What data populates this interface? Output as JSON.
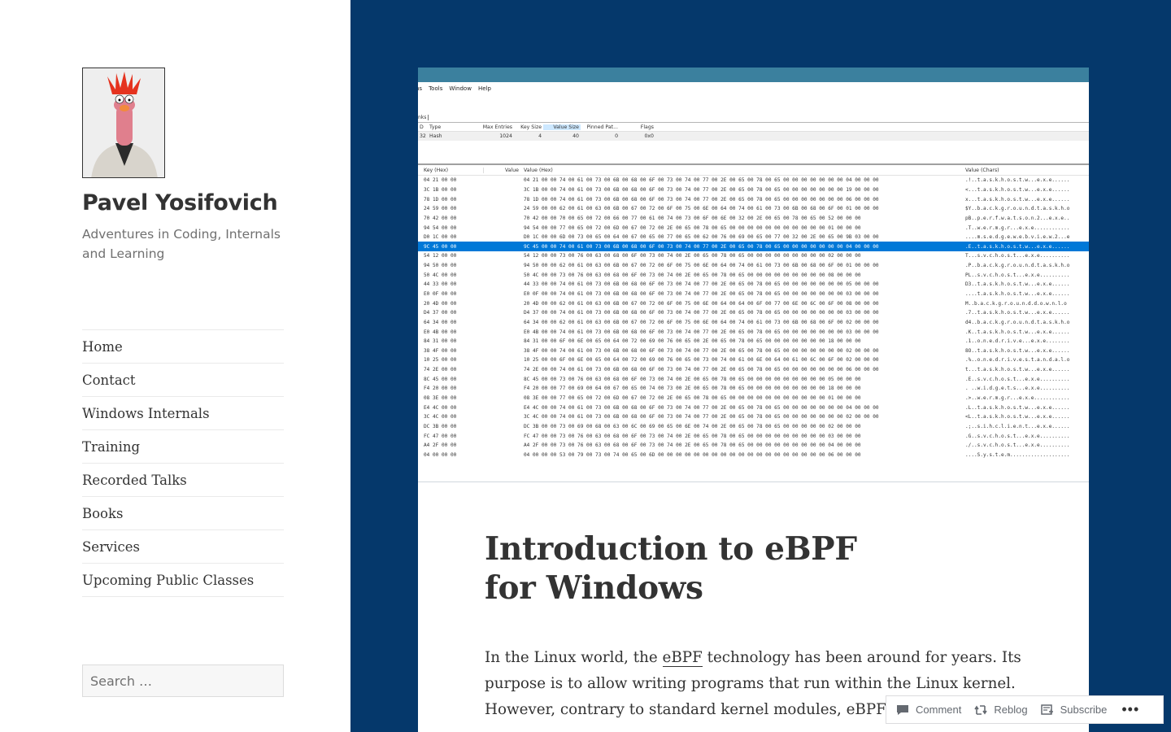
{
  "site": {
    "title": "Pavel Yosifovich",
    "description": "Adventures in Coding, Internals and Learning"
  },
  "nav": [
    "Home",
    "Contact",
    "Windows Internals",
    "Training",
    "Recorded Talks",
    "Books",
    "Services",
    "Upcoming Public Classes"
  ],
  "search": {
    "placeholder": "Search …"
  },
  "post": {
    "title_line1": "Introduction to eBPF",
    "title_line2": "for Windows",
    "body_p1_before": "In the Linux world, the ",
    "body_p1_link": "eBPF",
    "body_p1_after": " technology has been around for years. Its purpose is to allow writing programs that run within the Linux kernel. However, contrary to standard kernel modules, eBPF r"
  },
  "hero": {
    "menu": [
      "ns",
      "Tools",
      "Window",
      "Help"
    ],
    "tab": "nks",
    "maps_columns": [
      "D",
      "Type",
      "Max Entries",
      "Key Size",
      "Value Size",
      "Pinned Pat...",
      "Flags"
    ],
    "maps_row": [
      "32",
      "Hash",
      "1024",
      "4",
      "40",
      "0",
      "0x0"
    ],
    "hex_columns": [
      "Key (Hex)",
      "Value",
      "Value (Hex)",
      "Value (Chars)"
    ],
    "selected_index": 7,
    "hex_rows": [
      [
        "04 21 00 00",
        "04 21 00 00 74 00 61 00 73 00 6B 00 68 00 6F 00 73 00 74 00 77 00 2E 00 65 00 78 00 65 00 00 00 00 00 00 00 04 00 00 00",
        ".!..t.a.s.k.h.o.s.t.w...e.x.e......"
      ],
      [
        "3C 1B 00 00",
        "3C 1B 00 00 74 00 61 00 73 00 6B 00 68 00 6F 00 73 00 74 00 77 00 2E 00 65 00 78 00 65 00 00 00 00 00 00 00 19 00 00 00",
        "<...t.a.s.k.h.o.s.t.w...e.x.e......"
      ],
      [
        "78 1D 00 00",
        "78 1D 00 00 74 00 61 00 73 00 6B 00 68 00 6F 00 73 00 74 00 77 00 2E 00 65 00 78 00 65 00 00 00 00 00 00 00 06 00 00 00",
        "x...t.a.s.k.h.o.s.t.w...e.x.e......"
      ],
      [
        "24 59 00 00",
        "24 59 00 00 62 00 61 00 63 00 6B 00 67 00 72 00 6F 00 75 00 6E 00 64 00 74 00 61 00 73 00 6B 00 68 00 6F 00 01 00 00 00",
        "$Y..b.a.c.k.g.r.o.u.n.d.t.a.s.k.h.o"
      ],
      [
        "70 42 00 00",
        "70 42 00 00 70 00 65 00 72 00 66 00 77 00 61 00 74 00 73 00 6F 00 6E 00 32 00 2E 00 65 00 78 00 65 00 52 00 00 00",
        "pB..p.e.r.f.w.a.t.s.o.n.2...e.x.e.."
      ],
      [
        "94 54 00 00",
        "94 54 00 00 77 00 65 00 72 00 6D 00 67 00 72 00 2E 00 65 00 78 00 65 00 00 00 00 00 00 00 00 00 00 00 01 00 00 00",
        ".T..w.e.r.m.g.r...e.x.e............"
      ],
      [
        "D0 1C 00 00",
        "D0 1C 00 00 6D 00 73 00 65 00 64 00 67 00 65 00 77 00 65 00 62 00 76 00 69 00 65 00 77 00 32 00 2E 00 65 00 9B 03 00 00",
        "....m.s.e.d.g.e.w.e.b.v.i.e.w.2...e"
      ],
      [
        "9C 45 00 00",
        "9C 45 00 00 74 00 61 00 73 00 6B 00 68 00 6F 00 73 00 74 00 77 00 2E 00 65 00 78 00 65 00 00 00 00 00 00 00 04 00 00 00",
        ".E..t.a.s.k.h.o.s.t.w...e.x.e......"
      ],
      [
        "54 12 00 00",
        "54 12 00 00 73 00 76 00 63 00 68 00 6F 00 73 00 74 00 2E 00 65 00 78 00 65 00 00 00 00 00 00 00 00 00 02 00 00 00",
        "T...s.v.c.h.o.s.t...e.x.e.........."
      ],
      [
        "94 50 00 00",
        "94 50 00 00 62 00 61 00 63 00 6B 00 67 00 72 00 6F 00 75 00 6E 00 64 00 74 00 61 00 73 00 6B 00 68 00 6F 00 01 00 00 00",
        ".P..b.a.c.k.g.r.o.u.n.d.t.a.s.k.h.o"
      ],
      [
        "50 4C 00 00",
        "50 4C 00 00 73 00 76 00 63 00 68 00 6F 00 73 00 74 00 2E 00 65 00 78 00 65 00 00 00 00 00 00 00 00 00 08 00 00 00",
        "PL..s.v.c.h.o.s.t...e.x.e.........."
      ],
      [
        "44 33 00 00",
        "44 33 00 00 74 00 61 00 73 00 6B 00 68 00 6F 00 73 00 74 00 77 00 2E 00 65 00 78 00 65 00 00 00 00 00 00 00 05 00 00 00",
        "D3..t.a.s.k.h.o.s.t.w...e.x.e......"
      ],
      [
        "E0 0F 00 00",
        "E0 0F 00 00 74 00 61 00 73 00 6B 00 68 00 6F 00 73 00 74 00 77 00 2E 00 65 00 78 00 65 00 00 00 00 00 00 00 03 00 00 00",
        "....t.a.s.k.h.o.s.t.w...e.x.e......"
      ],
      [
        "20 4D 00 00",
        "20 4D 00 00 62 00 61 00 63 00 6B 00 67 00 72 00 6F 00 75 00 6E 00 64 00 64 00 6F 00 77 00 6E 00 6C 00 6F 00 08 00 00 00",
        " M..b.a.c.k.g.r.o.u.n.d.d.o.w.n.l.o"
      ],
      [
        "D4 37 00 00",
        "D4 37 00 00 74 00 61 00 73 00 6B 00 68 00 6F 00 73 00 74 00 77 00 2E 00 65 00 78 00 65 00 00 00 00 00 00 00 03 00 00 00",
        ".7..t.a.s.k.h.o.s.t.w...e.x.e......"
      ],
      [
        "64 34 00 00",
        "64 34 00 00 62 00 61 00 63 00 6B 00 67 00 72 00 6F 00 75 00 6E 00 64 00 74 00 61 00 73 00 6B 00 68 00 6F 00 02 00 00 00",
        "d4..b.a.c.k.g.r.o.u.n.d.t.a.s.k.h.o"
      ],
      [
        "E0 4B 00 00",
        "E0 4B 00 00 74 00 61 00 73 00 6B 00 68 00 6F 00 73 00 74 00 77 00 2E 00 65 00 78 00 65 00 00 00 00 00 00 00 03 00 00 00",
        ".K..t.a.s.k.h.o.s.t.w...e.x.e......"
      ],
      [
        "84 31 00 00",
        "84 31 00 00 6F 00 6E 00 65 00 64 00 72 00 69 00 76 00 65 00 2E 00 65 00 78 00 65 00 00 00 00 00 00 00 18 00 00 00",
        ".1..o.n.e.d.r.i.v.e...e.x.e........"
      ],
      [
        "38 4F 00 00",
        "38 4F 00 00 74 00 61 00 73 00 6B 00 68 00 6F 00 73 00 74 00 77 00 2E 00 65 00 78 00 65 00 00 00 00 00 00 00 02 00 00 00",
        "8O..t.a.s.k.h.o.s.t.w...e.x.e......"
      ],
      [
        "10 25 00 00",
        "10 25 00 00 6F 00 6E 00 65 00 64 00 72 00 69 00 76 00 65 00 73 00 74 00 61 00 6E 00 64 00 61 00 6C 00 6F 00 02 00 00 00",
        ".%..o.n.e.d.r.i.v.e.s.t.a.n.d.a.l.o"
      ],
      [
        "74 2E 00 00",
        "74 2E 00 00 74 00 61 00 73 00 6B 00 68 00 6F 00 73 00 74 00 77 00 2E 00 65 00 78 00 65 00 00 00 00 00 00 00 06 00 00 00",
        "t...t.a.s.k.h.o.s.t.w...e.x.e......"
      ],
      [
        "8C 45 00 00",
        "8C 45 00 00 73 00 76 00 63 00 68 00 6F 00 73 00 74 00 2E 00 65 00 78 00 65 00 00 00 00 00 00 00 00 00 05 00 00 00",
        ".E..s.v.c.h.o.s.t...e.x.e.........."
      ],
      [
        "F4 20 00 00",
        "F4 20 00 00 77 00 69 00 64 00 67 00 65 00 74 00 73 00 2E 00 65 00 78 00 65 00 00 00 00 00 00 00 00 00 18 00 00 00",
        ". ..w.i.d.g.e.t.s...e.x.e.........."
      ],
      [
        "08 3E 00 00",
        "08 3E 00 00 77 00 65 00 72 00 6D 00 67 00 72 00 2E 00 65 00 78 00 65 00 00 00 00 00 00 00 00 00 00 00 01 00 00 00",
        ".>..w.e.r.m.g.r...e.x.e............"
      ],
      [
        "E4 4C 00 00",
        "E4 4C 00 00 74 00 61 00 73 00 6B 00 68 00 6F 00 73 00 74 00 77 00 2E 00 65 00 78 00 65 00 00 00 00 00 00 00 04 00 00 00",
        ".L..t.a.s.k.h.o.s.t.w...e.x.e......"
      ],
      [
        "3C 4C 00 00",
        "3C 4C 00 00 74 00 61 00 73 00 6B 00 68 00 6F 00 73 00 74 00 77 00 2E 00 65 00 78 00 65 00 00 00 00 00 00 00 02 00 00 00",
        "<L..t.a.s.k.h.o.s.t.w...e.x.e......"
      ],
      [
        "DC 3B 00 00",
        "DC 3B 00 00 73 00 69 00 68 00 63 00 6C 00 69 00 65 00 6E 00 74 00 2E 00 65 00 78 00 65 00 00 00 00 00 02 00 00 00",
        ".;..s.i.h.c.l.i.e.n.t...e.x.e......"
      ],
      [
        "FC 47 00 00",
        "FC 47 00 00 73 00 76 00 63 00 68 00 6F 00 73 00 74 00 2E 00 65 00 78 00 65 00 00 00 00 00 00 00 00 00 03 00 00 00",
        ".G..s.v.c.h.o.s.t...e.x.e.........."
      ],
      [
        "A4 2F 00 00",
        "A4 2F 00 00 73 00 76 00 63 00 68 00 6F 00 73 00 74 00 2E 00 65 00 78 00 65 00 00 00 00 00 00 00 00 00 04 00 00 00",
        "./..s.v.c.h.o.s.t...e.x.e.........."
      ],
      [
        "04 00 00 00",
        "04 00 00 00 53 00 79 00 73 00 74 00 65 00 6D 00 00 00 00 00 00 00 00 00 00 00 00 00 00 00 00 00 00 00 06 00 00 00",
        "....S.y.s.t.e.m...................."
      ]
    ]
  },
  "actions": {
    "comment": "Comment",
    "reblog": "Reblog",
    "subscribe": "Subscribe",
    "more": "•••"
  },
  "colors": {
    "background": "#05386b",
    "selection": "#0078d7",
    "titlebar": "#3b809e"
  }
}
